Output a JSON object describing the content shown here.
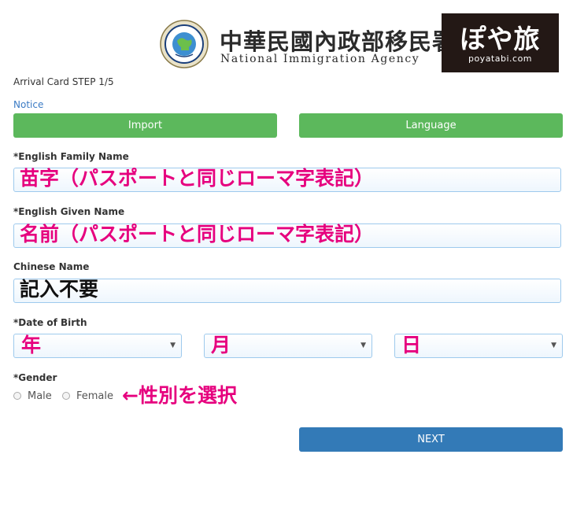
{
  "header": {
    "agency_name_zh": "中華民國內政部移民署",
    "agency_name_en": "National Immigration Agency",
    "brand_name": "ぽや旅",
    "brand_url": "poyatabi.com"
  },
  "form": {
    "step_label": "Arrival Card STEP 1/5",
    "notice_link": "Notice",
    "import_label": "Import",
    "language_label": "Language",
    "family_name_label": "*English Family Name",
    "given_name_label": "*English Given Name",
    "chinese_name_label": "Chinese Name",
    "dob_label": "*Date of Birth",
    "gender_label": "*Gender",
    "gender_options": [
      "Male",
      "Female"
    ],
    "next_label": "NEXT"
  },
  "annotations": {
    "family_name_note": "苗字（パスポートと同じローマ字表記）",
    "given_name_note": "名前（パスポートと同じローマ字表記）",
    "chinese_name_note": "記入不要",
    "dob_year_note": "年",
    "dob_month_note": "月",
    "dob_day_note": "日",
    "gender_note": "←性別を選択"
  },
  "colors": {
    "green_button": "#5cb85c",
    "blue_button": "#337ab7",
    "annotation_pink": "#e6007e",
    "link_blue": "#3b7bc4",
    "input_border": "#9ecaed"
  }
}
